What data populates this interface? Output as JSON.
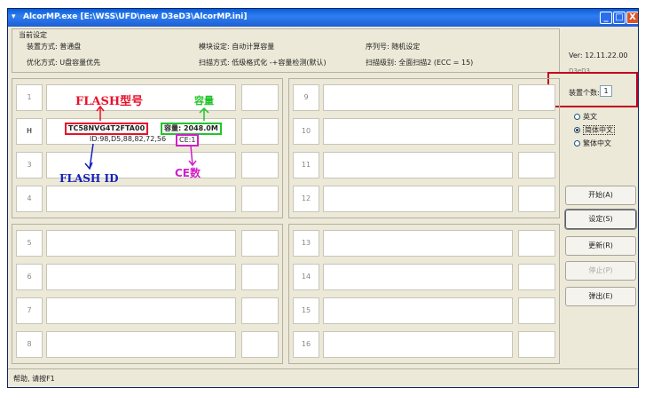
{
  "window": {
    "title": "AlcorMP.exe [E:\\WSS\\UFD\\new D3eD3\\AlcorMP.ini]",
    "buttons": {
      "minimize": "_",
      "maximize": "□",
      "close": "X"
    }
  },
  "settings": {
    "group_title": "当前设定",
    "device_mode": "装置方式: 普通盘",
    "optimize_mode": "优化方式: U盘容量优先",
    "module_setting": "模块设定: 自动计算容量",
    "scan_mode": "扫描方式: 低级格式化 -+容量检测(默认)",
    "serial": "序列号: 随机设定",
    "scan_level": "扫描级别: 全面扫描2 (ECC = 15)"
  },
  "side": {
    "version": "Ver: 12.11.22.00",
    "version_sub": "D3eD3",
    "device_count_label": "装置个数:",
    "device_count_value": "1",
    "languages": [
      {
        "label": "英文",
        "selected": false
      },
      {
        "label": "简体中文",
        "selected": true
      },
      {
        "label": "繁体中文",
        "selected": false
      }
    ],
    "buttons": {
      "start": "开始(A)",
      "settings": "设定(S)",
      "refresh": "更新(R)",
      "stop": "停止(P)",
      "exit": "弹出(E)"
    }
  },
  "ports": {
    "top_left": [
      "1",
      "H",
      "3",
      "4"
    ],
    "top_right": [
      "9",
      "10",
      "11",
      "12"
    ],
    "bottom_left": [
      "5",
      "6",
      "7",
      "8"
    ],
    "bottom_right": [
      "13",
      "14",
      "15",
      "16"
    ]
  },
  "device_info": {
    "flash_model": "TC58NVG4T2FTA00",
    "capacity": "容量: 2048.0M",
    "id": "ID:98,D5,88,82,72,56",
    "ce": "CE:1"
  },
  "annotations": {
    "flash_model": "FLASH型号",
    "capacity": "容量",
    "flash_id": "FLASH ID",
    "ce_count": "CE数"
  },
  "colors": {
    "flash_model": "#e8102a",
    "capacity": "#22c42a",
    "flash_id": "#1420b8",
    "ce_count": "#d020c8",
    "highlight_box": "#c0001e"
  },
  "statusbar": {
    "text": "帮助, 请按F1"
  }
}
